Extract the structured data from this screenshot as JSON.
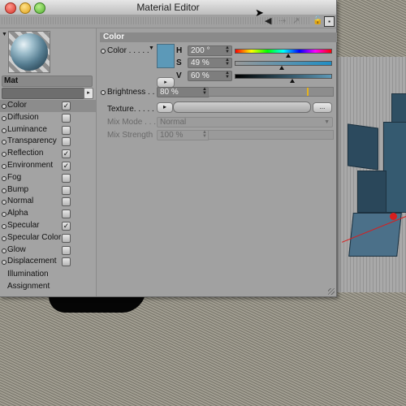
{
  "window": {
    "title": "Material Editor"
  },
  "toolbar": {
    "back_icon": "arrow-left-icon",
    "forward_icon": "arrow-right-icon",
    "lock_icon": "lock-icon",
    "menu_icon": "panel-menu-icon"
  },
  "material": {
    "name": "Mat"
  },
  "channels": [
    {
      "label": "Color",
      "checked": true,
      "active": true
    },
    {
      "label": "Diffusion",
      "checked": false
    },
    {
      "label": "Luminance",
      "checked": false
    },
    {
      "label": "Transparency",
      "checked": false
    },
    {
      "label": "Reflection",
      "checked": true
    },
    {
      "label": "Environment",
      "checked": true
    },
    {
      "label": "Fog",
      "checked": false
    },
    {
      "label": "Bump",
      "checked": false
    },
    {
      "label": "Normal",
      "checked": false
    },
    {
      "label": "Alpha",
      "checked": false
    },
    {
      "label": "Specular",
      "checked": true
    },
    {
      "label": "Specular Color",
      "checked": false
    },
    {
      "label": "Glow",
      "checked": false
    },
    {
      "label": "Displacement",
      "checked": false
    }
  ],
  "extra_items": [
    "Illumination",
    "Assignment"
  ],
  "checkmark": "✓",
  "color_section": {
    "header": "Color",
    "color_label": "Color . . . . .",
    "swatch_color": "#5c99b8",
    "h_label": "H",
    "h_value": "200 °",
    "s_label": "S",
    "s_value": "49 %",
    "v_label": "V",
    "v_value": "60 %",
    "h_fraction": 0.556,
    "s_fraction": 0.49,
    "v_fraction": 0.6,
    "brightness_label": "Brightness . .",
    "brightness_value": "80 %",
    "brightness_fraction": 0.8,
    "texture_label": "Texture. . . . .",
    "texture_browse": "...",
    "mix_mode_label": "Mix Mode . . .",
    "mix_mode_value": "Normal",
    "mix_strength_label": "Mix Strength",
    "mix_strength_value": "100 %"
  }
}
